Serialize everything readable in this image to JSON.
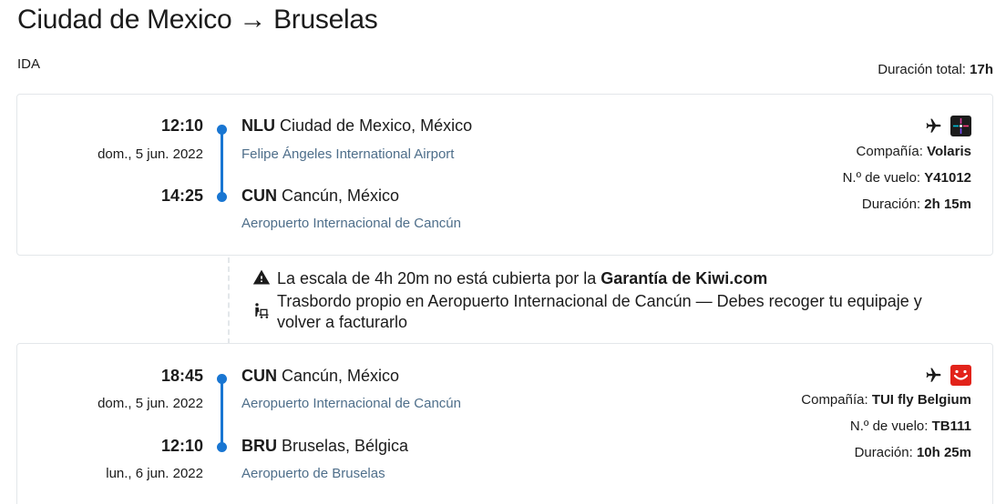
{
  "header": {
    "title": "Ciudad de Mexico → Bruselas",
    "direction": "IDA",
    "total_label": "Duración total: ",
    "total_value": "17h"
  },
  "segments": [
    {
      "dep_time": "12:10",
      "dep_date": "dom., 5 jun. 2022",
      "dep_code": "NLU",
      "dep_city": " Ciudad de Mexico, México",
      "dep_airport": "Felipe Ángeles International Airport",
      "arr_time": "14:25",
      "arr_code": "CUN",
      "arr_city": " Cancún, México",
      "arr_airport": "Aeropuerto Internacional de Cancún",
      "airline_label": "Compañía: ",
      "airline": "Volaris",
      "flight_label": "N.º de vuelo: ",
      "flight": "Y41012",
      "duration_label": "Duración: ",
      "duration": "2h 15m"
    },
    {
      "dep_time": "18:45",
      "dep_date": "dom., 5 jun. 2022",
      "dep_code": "CUN",
      "dep_city": " Cancún, México",
      "dep_airport": "Aeropuerto Internacional de Cancún",
      "arr_time": "12:10",
      "arr_date": "lun., 6 jun. 2022",
      "arr_code": "BRU",
      "arr_city": " Bruselas, Bélgica",
      "arr_airport": "Aeropuerto de Bruselas",
      "airline_label": "Compañía: ",
      "airline": "TUI fly Belgium",
      "flight_label": "N.º de vuelo: ",
      "flight": "TB111",
      "duration_label": "Duración: ",
      "duration": "10h 25m"
    }
  ],
  "layover": {
    "warning_text": "La escala de 4h 20m no está cubierta por la ",
    "warning_link": "Garantía de Kiwi.com",
    "transfer_text": "Trasbordo propio en Aeropuerto Internacional de Cancún — Debes recoger tu equipaje y volver a facturarlo"
  },
  "icons": {
    "plane": "plane-icon",
    "warning": "warning-icon",
    "baggage": "baggage-trolley-icon"
  },
  "colors": {
    "accent": "#1976d2",
    "airport_text": "#4e6e8a",
    "tui_red": "#e2231a"
  }
}
